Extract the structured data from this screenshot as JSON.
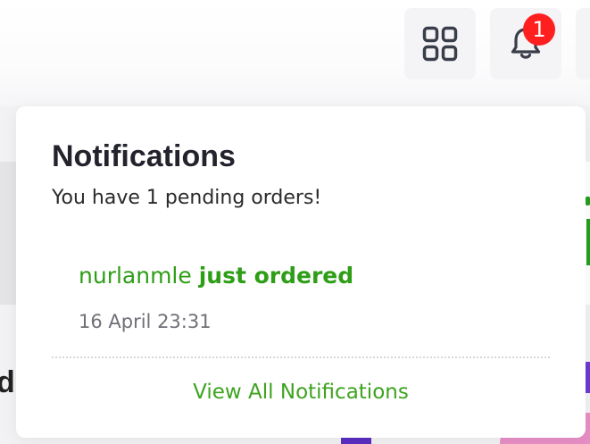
{
  "header": {
    "apps_icon": "grid-icon",
    "notifications_icon": "bell-icon",
    "notification_count": "1"
  },
  "background": {
    "partial_letter": "d"
  },
  "notifications_dropdown": {
    "title": "Notifications",
    "subtitle": "You have 1 pending orders!",
    "items": [
      {
        "user": "nurlanmle",
        "action": "just ordered",
        "time": "16 April 23:31"
      }
    ],
    "view_all_label": "View All Notifications"
  },
  "colors": {
    "accent_green": "#2e9e17",
    "badge_red": "#ff1f1f",
    "title_text": "#23232d",
    "muted_text": "#6f6f77"
  }
}
